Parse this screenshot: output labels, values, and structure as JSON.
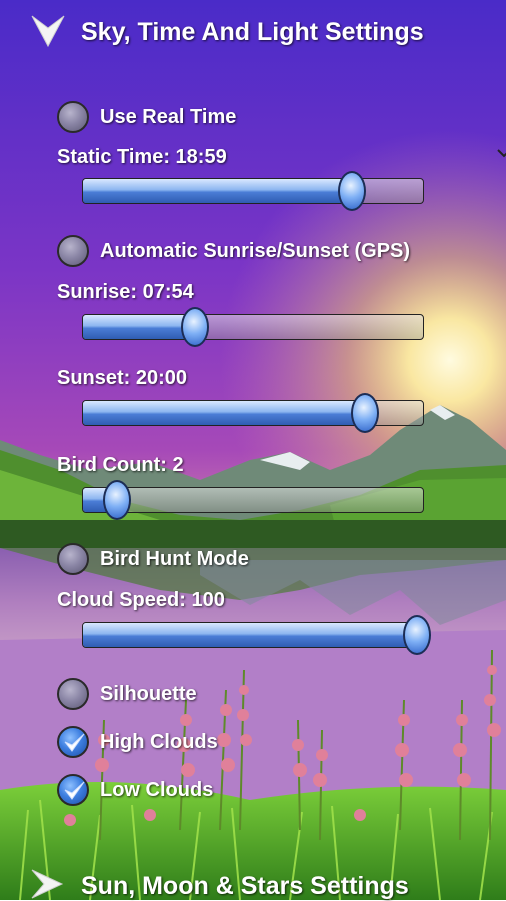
{
  "header": {
    "title": "Sky, Time And Light Settings"
  },
  "options": {
    "use_real_time": {
      "label": "Use Real Time",
      "checked": false
    },
    "automatic_sunrise": {
      "label": "Automatic Sunrise/Sunset (GPS)",
      "checked": false
    },
    "bird_hunt_mode": {
      "label": "Bird Hunt Mode",
      "checked": false
    },
    "silhouette": {
      "label": "Silhouette",
      "checked": false
    },
    "high_clouds": {
      "label": "High Clouds",
      "checked": true
    },
    "low_clouds": {
      "label": "Low Clouds",
      "checked": true
    }
  },
  "sliders": {
    "static_time": {
      "label": "Static Time: 18:59",
      "value": 0.79
    },
    "sunrise": {
      "label": "Sunrise: 07:54",
      "value": 0.33
    },
    "sunset": {
      "label": "Sunset: 20:00",
      "value": 0.83
    },
    "bird_count": {
      "label": "Bird Count: 2",
      "value": 0.1
    },
    "cloud_speed": {
      "label": "Cloud Speed: 100",
      "value": 1.0
    }
  },
  "footer": {
    "title": "Sun, Moon & Stars Settings"
  },
  "colors": {
    "accent": "#4b7dd6",
    "sky_top": "#5a2fc0",
    "sky_mid": "#8a3fc4",
    "sun": "#fff4a8"
  }
}
